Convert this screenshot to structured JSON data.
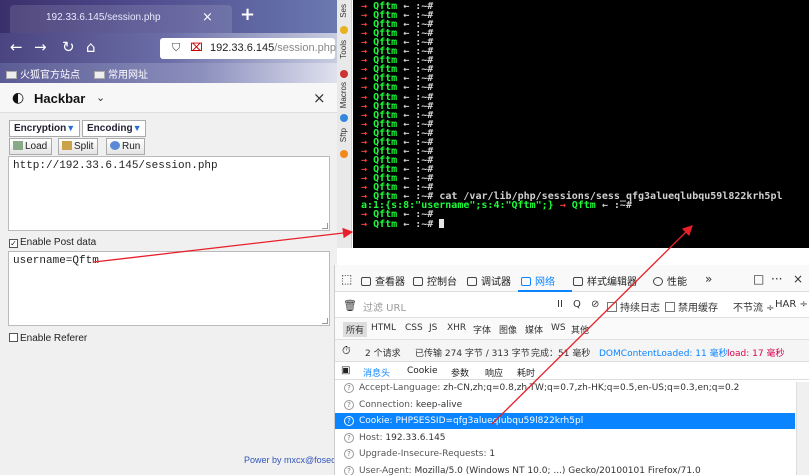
{
  "browser": {
    "tab_title": "192.33.6.145/session.php",
    "tab_close": "×",
    "new_tab": "+",
    "url_host": "192.33.6.145",
    "url_path": "/session.php",
    "bookmarks": [
      "火狐官方站点",
      "常用网址"
    ]
  },
  "hackbar": {
    "title": "Hackbar",
    "chevron": "⌄",
    "close": "×",
    "encryption_label": "Encryption",
    "encoding_label": "Encoding",
    "load_label": "Load",
    "split_label": "Split",
    "run_label": "Run",
    "url_value": "http://192.33.6.145/session.php",
    "enable_post_label": "Enable Post data",
    "enable_post_checked": true,
    "post_value": "username=Qftm",
    "enable_referer_label": "Enable Referer",
    "powered_by": "Power by mxcx@fosec.vn"
  },
  "side_toolbar": {
    "labels": [
      "Ses",
      "Tools",
      "Macros",
      "Sftp"
    ]
  },
  "terminal": {
    "prompt_arrow": "→",
    "prompt_user": "Qftm",
    "prompt_sep": "← :~#",
    "command": "cat /var/lib/php/sessions/sess_qfg3alueqlubqu59l822krh5pl",
    "output": "a:1:{s:8:\"username\";s:4:\"Qftm\";}"
  },
  "devtools": {
    "tabs": [
      "查看器",
      "控制台",
      "调试器",
      "网络",
      "样式编辑器",
      "性能"
    ],
    "more": "»",
    "right_icons": [
      "□",
      "···",
      "×"
    ],
    "filter_placeholder": "过滤 URL",
    "pause_icon": "II",
    "search_icon": "Q",
    "persist_log_label": "持续日志",
    "disable_cache_label": "禁用缓存",
    "throttle_label": "不节流 ÷",
    "har_label": "HAR ÷",
    "types": [
      "所有",
      "HTML",
      "CSS",
      "JS",
      "XHR",
      "字体",
      "图像",
      "媒体",
      "WS",
      "其他"
    ],
    "status": {
      "requests": "2 个请求",
      "transferred": "已传输 274 字节 / 313 字节",
      "finish": "完成：51 毫秒",
      "dom_loaded": "DOMContentLoaded: 11 毫秒",
      "load": "load: 17 毫秒"
    },
    "subtabs": [
      "消息头",
      "Cookie",
      "参数",
      "响应",
      "耗时"
    ],
    "headers": [
      {
        "key": "Accept-Language:",
        "value": "zh-CN,zh;q=0.8,zh-TW;q=0.7,zh-HK;q=0.5,en-US;q=0.3,en;q=0.2"
      },
      {
        "key": "Connection:",
        "value": "keep-alive"
      },
      {
        "key": "Cookie:",
        "value": "PHPSESSID=qfg3alueqlubqu59l822krh5pl"
      },
      {
        "key": "Host:",
        "value": "192.33.6.145"
      },
      {
        "key": "Upgrade-Insecure-Requests:",
        "value": "1"
      },
      {
        "key": "User-Agent:",
        "value": "Mozilla/5.0 (Windows NT 10.0; ...) Gecko/20100101 Firefox/71.0"
      }
    ]
  },
  "colors": {
    "terminal_text": "#1cfa3a",
    "terminal_arrow": "#ff4040",
    "annotation": "#e8202a",
    "accent": "#0a84ff"
  }
}
